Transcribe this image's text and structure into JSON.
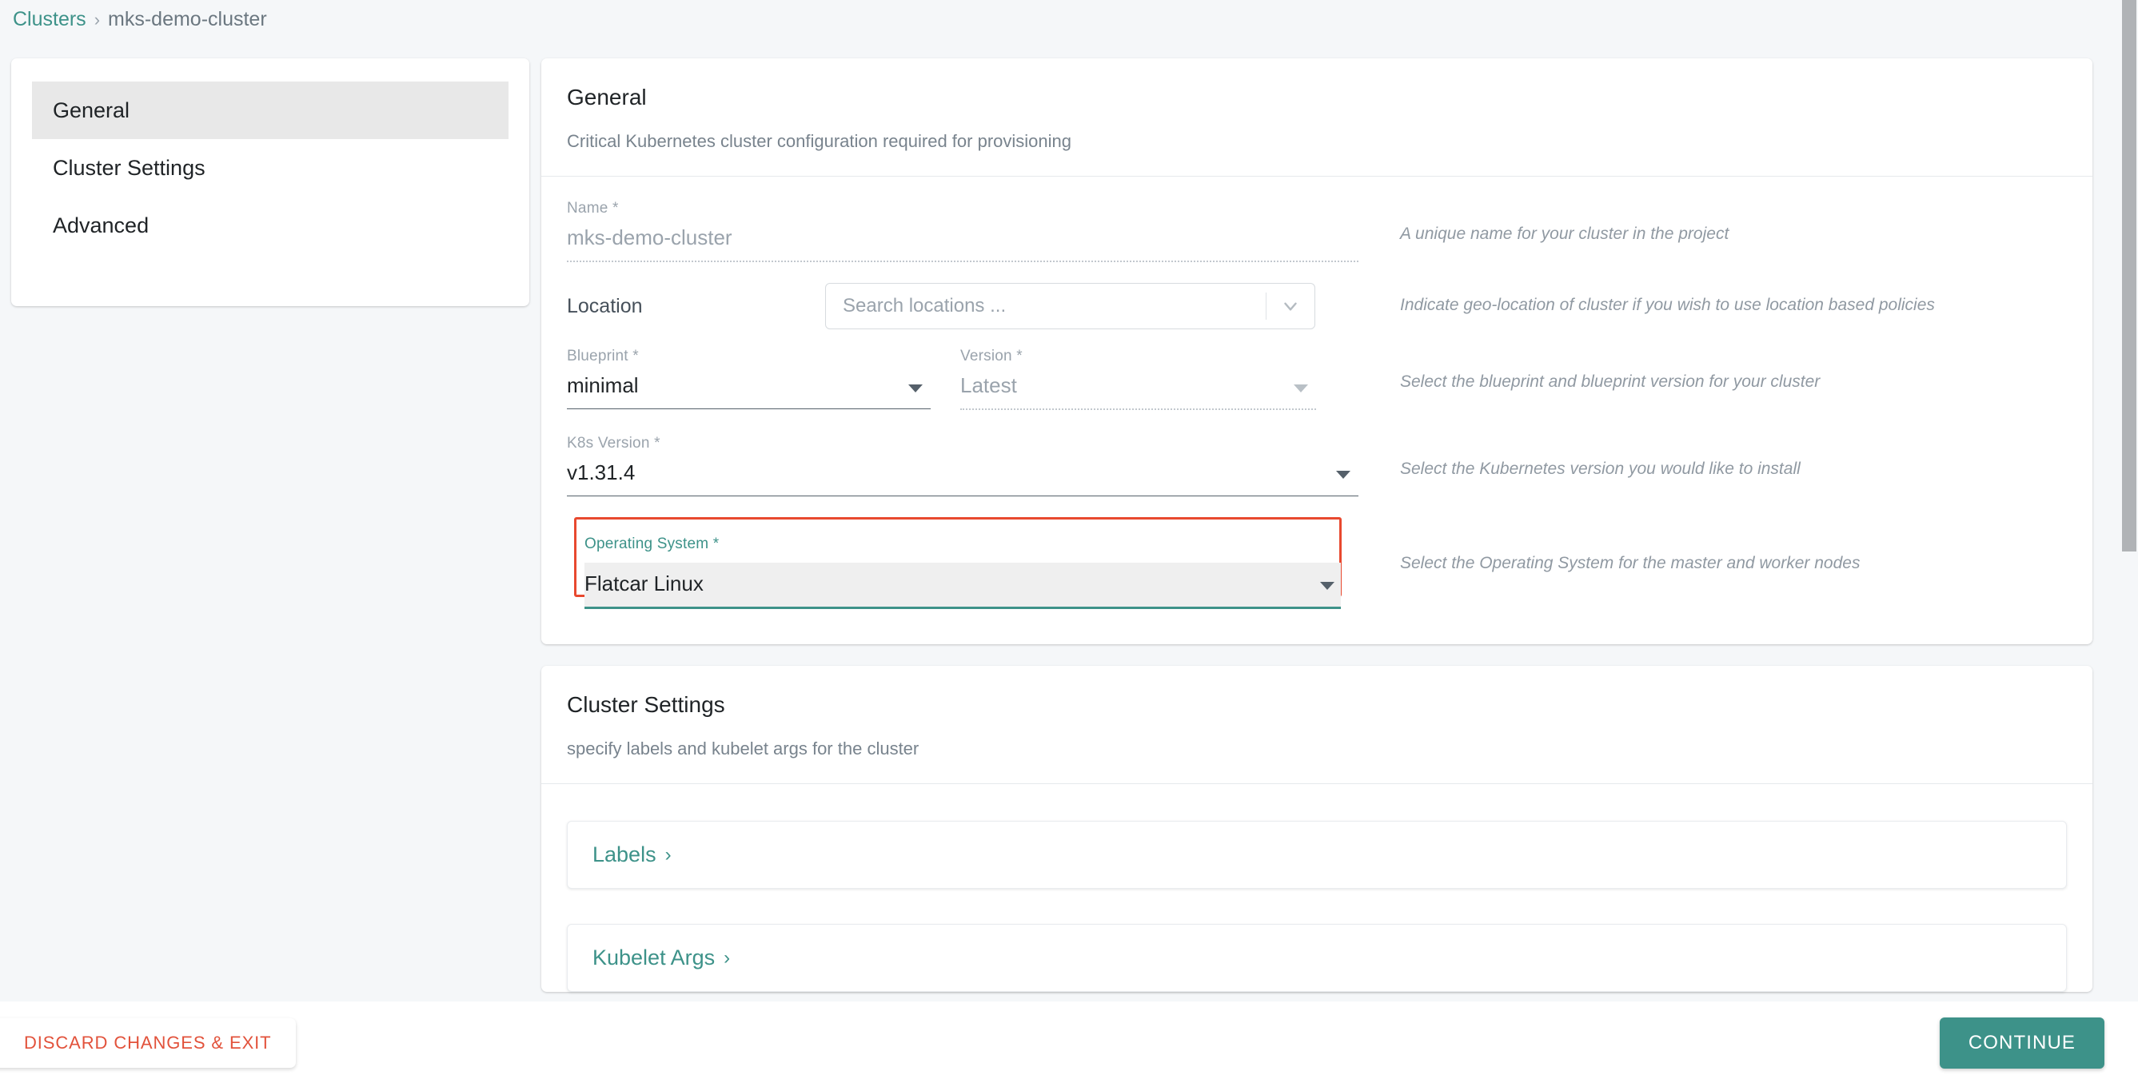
{
  "breadcrumb": {
    "root": "Clusters",
    "separator": "›",
    "current": "mks-demo-cluster"
  },
  "sidebar": {
    "items": [
      {
        "label": "General",
        "active": true
      },
      {
        "label": "Cluster Settings",
        "active": false
      },
      {
        "label": "Advanced",
        "active": false
      }
    ]
  },
  "general": {
    "title": "General",
    "subtitle": "Critical Kubernetes cluster configuration required for provisioning",
    "name": {
      "label": "Name *",
      "value": "mks-demo-cluster",
      "hint": "A unique name for your cluster in the project"
    },
    "location": {
      "label": "Location",
      "placeholder": "Search locations ...",
      "hint": "Indicate geo-location of cluster if you wish to use location based policies"
    },
    "blueprint": {
      "label": "Blueprint *",
      "value": "minimal"
    },
    "version": {
      "label": "Version *",
      "value": "Latest",
      "hint": "Select the blueprint and blueprint version for your cluster"
    },
    "k8s_version": {
      "label": "K8s Version *",
      "value": "v1.31.4",
      "hint": "Select the Kubernetes version you would like to install"
    },
    "operating_system": {
      "label": "Operating System *",
      "value": "Flatcar Linux",
      "hint": "Select the Operating System for the master and worker nodes"
    }
  },
  "cluster_settings": {
    "title": "Cluster Settings",
    "subtitle": "specify labels and kubelet args for the cluster",
    "tiles": [
      {
        "label": "Labels",
        "chevron": "›"
      },
      {
        "label": "Kubelet Args",
        "chevron": "›"
      }
    ]
  },
  "footer": {
    "discard_label": "DISCARD CHANGES & EXIT",
    "continue_label": "CONTINUE"
  },
  "colors": {
    "accent_teal": "#3d9289",
    "danger_red": "#e2523b",
    "highlight_outline": "#e8492f",
    "page_bg": "#f5f7f9"
  }
}
